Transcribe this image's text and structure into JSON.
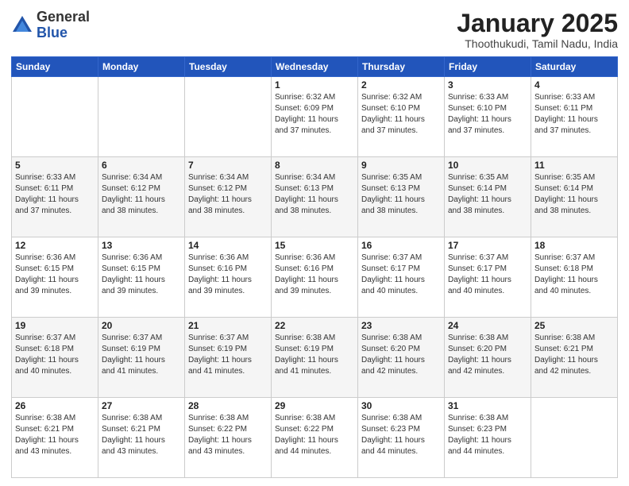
{
  "header": {
    "logo_general": "General",
    "logo_blue": "Blue",
    "month_title": "January 2025",
    "subtitle": "Thoothukudi, Tamil Nadu, India"
  },
  "weekdays": [
    "Sunday",
    "Monday",
    "Tuesday",
    "Wednesday",
    "Thursday",
    "Friday",
    "Saturday"
  ],
  "weeks": [
    [
      {
        "day": "",
        "info": ""
      },
      {
        "day": "",
        "info": ""
      },
      {
        "day": "",
        "info": ""
      },
      {
        "day": "1",
        "info": "Sunrise: 6:32 AM\nSunset: 6:09 PM\nDaylight: 11 hours\nand 37 minutes."
      },
      {
        "day": "2",
        "info": "Sunrise: 6:32 AM\nSunset: 6:10 PM\nDaylight: 11 hours\nand 37 minutes."
      },
      {
        "day": "3",
        "info": "Sunrise: 6:33 AM\nSunset: 6:10 PM\nDaylight: 11 hours\nand 37 minutes."
      },
      {
        "day": "4",
        "info": "Sunrise: 6:33 AM\nSunset: 6:11 PM\nDaylight: 11 hours\nand 37 minutes."
      }
    ],
    [
      {
        "day": "5",
        "info": "Sunrise: 6:33 AM\nSunset: 6:11 PM\nDaylight: 11 hours\nand 37 minutes."
      },
      {
        "day": "6",
        "info": "Sunrise: 6:34 AM\nSunset: 6:12 PM\nDaylight: 11 hours\nand 38 minutes."
      },
      {
        "day": "7",
        "info": "Sunrise: 6:34 AM\nSunset: 6:12 PM\nDaylight: 11 hours\nand 38 minutes."
      },
      {
        "day": "8",
        "info": "Sunrise: 6:34 AM\nSunset: 6:13 PM\nDaylight: 11 hours\nand 38 minutes."
      },
      {
        "day": "9",
        "info": "Sunrise: 6:35 AM\nSunset: 6:13 PM\nDaylight: 11 hours\nand 38 minutes."
      },
      {
        "day": "10",
        "info": "Sunrise: 6:35 AM\nSunset: 6:14 PM\nDaylight: 11 hours\nand 38 minutes."
      },
      {
        "day": "11",
        "info": "Sunrise: 6:35 AM\nSunset: 6:14 PM\nDaylight: 11 hours\nand 38 minutes."
      }
    ],
    [
      {
        "day": "12",
        "info": "Sunrise: 6:36 AM\nSunset: 6:15 PM\nDaylight: 11 hours\nand 39 minutes."
      },
      {
        "day": "13",
        "info": "Sunrise: 6:36 AM\nSunset: 6:15 PM\nDaylight: 11 hours\nand 39 minutes."
      },
      {
        "day": "14",
        "info": "Sunrise: 6:36 AM\nSunset: 6:16 PM\nDaylight: 11 hours\nand 39 minutes."
      },
      {
        "day": "15",
        "info": "Sunrise: 6:36 AM\nSunset: 6:16 PM\nDaylight: 11 hours\nand 39 minutes."
      },
      {
        "day": "16",
        "info": "Sunrise: 6:37 AM\nSunset: 6:17 PM\nDaylight: 11 hours\nand 40 minutes."
      },
      {
        "day": "17",
        "info": "Sunrise: 6:37 AM\nSunset: 6:17 PM\nDaylight: 11 hours\nand 40 minutes."
      },
      {
        "day": "18",
        "info": "Sunrise: 6:37 AM\nSunset: 6:18 PM\nDaylight: 11 hours\nand 40 minutes."
      }
    ],
    [
      {
        "day": "19",
        "info": "Sunrise: 6:37 AM\nSunset: 6:18 PM\nDaylight: 11 hours\nand 40 minutes."
      },
      {
        "day": "20",
        "info": "Sunrise: 6:37 AM\nSunset: 6:19 PM\nDaylight: 11 hours\nand 41 minutes."
      },
      {
        "day": "21",
        "info": "Sunrise: 6:37 AM\nSunset: 6:19 PM\nDaylight: 11 hours\nand 41 minutes."
      },
      {
        "day": "22",
        "info": "Sunrise: 6:38 AM\nSunset: 6:19 PM\nDaylight: 11 hours\nand 41 minutes."
      },
      {
        "day": "23",
        "info": "Sunrise: 6:38 AM\nSunset: 6:20 PM\nDaylight: 11 hours\nand 42 minutes."
      },
      {
        "day": "24",
        "info": "Sunrise: 6:38 AM\nSunset: 6:20 PM\nDaylight: 11 hours\nand 42 minutes."
      },
      {
        "day": "25",
        "info": "Sunrise: 6:38 AM\nSunset: 6:21 PM\nDaylight: 11 hours\nand 42 minutes."
      }
    ],
    [
      {
        "day": "26",
        "info": "Sunrise: 6:38 AM\nSunset: 6:21 PM\nDaylight: 11 hours\nand 43 minutes."
      },
      {
        "day": "27",
        "info": "Sunrise: 6:38 AM\nSunset: 6:21 PM\nDaylight: 11 hours\nand 43 minutes."
      },
      {
        "day": "28",
        "info": "Sunrise: 6:38 AM\nSunset: 6:22 PM\nDaylight: 11 hours\nand 43 minutes."
      },
      {
        "day": "29",
        "info": "Sunrise: 6:38 AM\nSunset: 6:22 PM\nDaylight: 11 hours\nand 44 minutes."
      },
      {
        "day": "30",
        "info": "Sunrise: 6:38 AM\nSunset: 6:23 PM\nDaylight: 11 hours\nand 44 minutes."
      },
      {
        "day": "31",
        "info": "Sunrise: 6:38 AM\nSunset: 6:23 PM\nDaylight: 11 hours\nand 44 minutes."
      },
      {
        "day": "",
        "info": ""
      }
    ]
  ]
}
